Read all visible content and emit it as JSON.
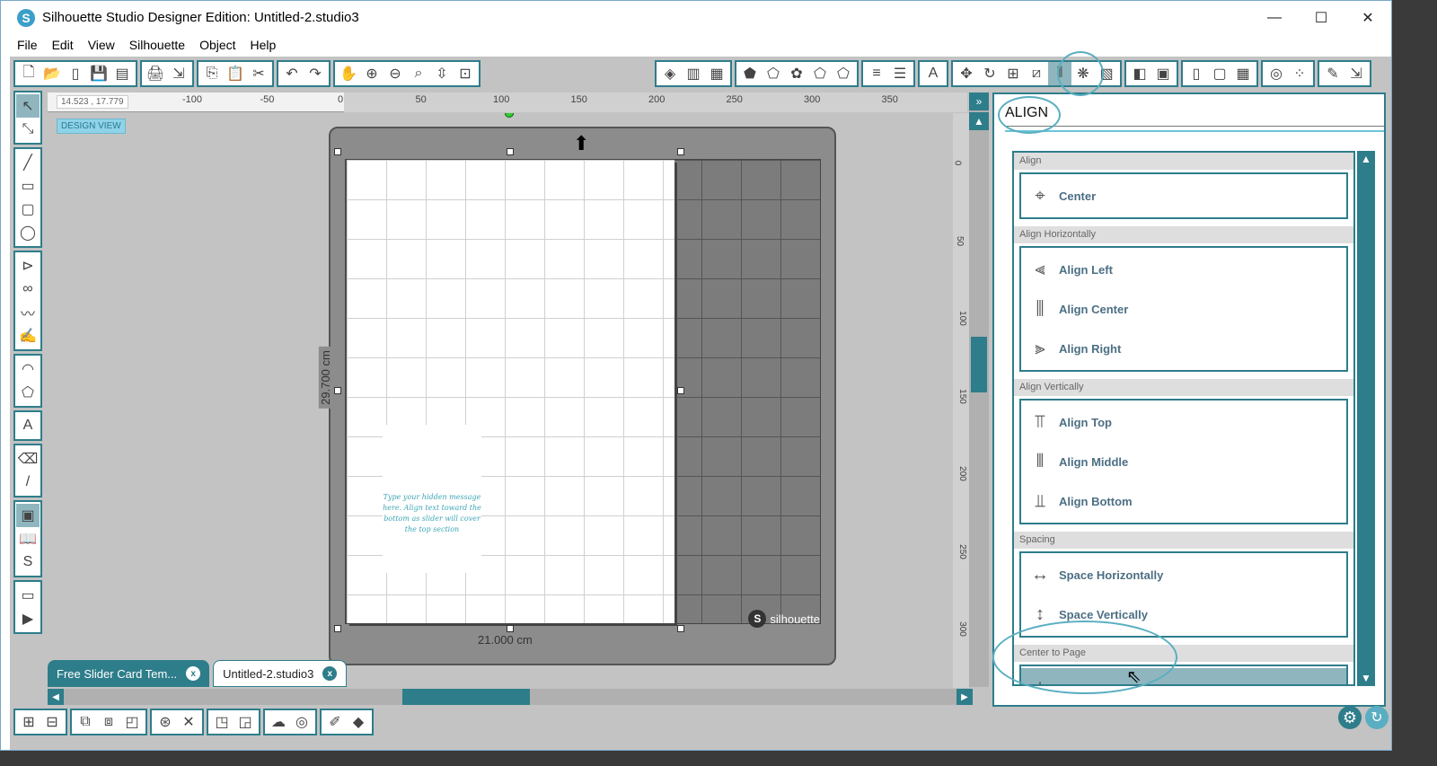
{
  "window": {
    "title": "Silhouette Studio Designer Edition: Untitled-2.studio3",
    "logo_letter": "S",
    "minimize": "—",
    "maximize": "☐",
    "close": "✕"
  },
  "menu": [
    "File",
    "Edit",
    "View",
    "Silhouette",
    "Object",
    "Help"
  ],
  "toolbar_left": [
    [
      [
        "new-page-icon",
        "🗋"
      ],
      [
        "open-icon",
        "📂"
      ],
      [
        "blank-page-icon",
        "▯"
      ],
      [
        "save-icon",
        "💾"
      ],
      [
        "save-library-icon",
        "▤"
      ]
    ],
    [
      [
        "print-icon",
        "🖨"
      ],
      [
        "send-icon",
        "⇲"
      ]
    ],
    [
      [
        "copy-icon",
        "⎘"
      ],
      [
        "paste-icon",
        "📋"
      ],
      [
        "cut-icon",
        "✂"
      ]
    ],
    [
      [
        "undo-icon",
        "↶"
      ],
      [
        "redo-icon",
        "↷"
      ]
    ],
    [
      [
        "pan-icon",
        "✋"
      ],
      [
        "zoom-in-icon",
        "⊕"
      ],
      [
        "zoom-out-icon",
        "⊖"
      ],
      [
        "zoom-select-icon",
        "⌕"
      ],
      [
        "zoom-drag-icon",
        "⇳"
      ],
      [
        "fit-page-icon",
        "⊡"
      ]
    ]
  ],
  "toolbar_right": [
    [
      [
        "fill-color-icon",
        "◈"
      ],
      [
        "gradient-icon",
        "▥"
      ],
      [
        "pattern-icon",
        "▦"
      ]
    ],
    [
      [
        "shape-fill-icon",
        "⬟"
      ],
      [
        "pentagon-icon",
        "⬠"
      ],
      [
        "flower-icon",
        "✿"
      ],
      [
        "shape-edit-icon",
        "⬠"
      ],
      [
        "knife-shape-icon",
        "⬠"
      ]
    ],
    [
      [
        "line-color-icon",
        "≡"
      ],
      [
        "line-style-icon",
        "☰"
      ]
    ],
    [
      [
        "text-style-icon",
        "A"
      ]
    ],
    [
      [
        "transform-icon",
        "✥"
      ],
      [
        "rotate-icon",
        "↻"
      ],
      [
        "scale-icon",
        "⊞"
      ],
      [
        "shear-icon",
        "⧄"
      ],
      [
        "align-icon",
        "⫴"
      ],
      [
        "replicate-icon",
        "❋"
      ],
      [
        "modify-icon",
        "▧"
      ]
    ],
    [
      [
        "trace-icon",
        "◧"
      ],
      [
        "offset-icon",
        "▣"
      ]
    ],
    [
      [
        "page-setup-icon",
        "▯"
      ],
      [
        "cut-settings-icon",
        "▢"
      ],
      [
        "grid-icon",
        "▦"
      ]
    ],
    [
      [
        "spiral-icon",
        "◎"
      ],
      [
        "dots-icon",
        "⁘"
      ]
    ],
    [
      [
        "eraser-icon",
        "✎"
      ],
      [
        "send-to-icon",
        "⇲"
      ]
    ]
  ],
  "left_tools": [
    [
      [
        "select-tool-icon",
        "↖"
      ],
      [
        "point-edit-icon",
        "⤡"
      ]
    ],
    [
      [
        "line-tool-icon",
        "╱"
      ],
      [
        "rectangle-tool-icon",
        "▭"
      ],
      [
        "rounded-rect-tool-icon",
        "▢"
      ],
      [
        "ellipse-tool-icon",
        "◯"
      ]
    ],
    [
      [
        "polygon-tool-icon",
        "⊳"
      ],
      [
        "curve-tool-icon",
        "∞"
      ],
      [
        "freehand-tool-icon",
        "〰"
      ],
      [
        "smooth-freehand-icon",
        "✍"
      ]
    ],
    [
      [
        "arc-tool-icon",
        "◠"
      ],
      [
        "regular-polygon-icon",
        "⬠"
      ]
    ],
    [
      [
        "text-tool-icon",
        "A"
      ]
    ],
    [
      [
        "eraser-tool-icon",
        "⌫"
      ],
      [
        "knife-tool-icon",
        "/"
      ]
    ],
    [
      [
        "library-view-icon",
        "▣"
      ],
      [
        "store-icon",
        "📖"
      ],
      [
        "silhouette-store-icon",
        "S"
      ]
    ],
    [
      [
        "design-view-icon",
        "▭"
      ],
      [
        "send-panel-icon",
        "▶"
      ]
    ]
  ],
  "canvas": {
    "coords": "14.523 , 17.779",
    "view_label": "DESIGN VIEW",
    "ruler_x": [
      "-100",
      "-50",
      "0",
      "50",
      "100",
      "150",
      "200",
      "250",
      "300",
      "350"
    ],
    "ruler_y": [
      "0",
      "50",
      "100",
      "150",
      "200",
      "250",
      "300"
    ],
    "width_dim": "21.000 cm",
    "height_dim": "29.700 cm",
    "brand": "silhouette",
    "message": "Type your hidden message here. Align text toward the bottom as slider will cover the top section"
  },
  "tabs": [
    {
      "label": "Free Slider Card Tem...",
      "close": "x"
    },
    {
      "label": "Untitled-2.studio3",
      "close": "x"
    }
  ],
  "panel": {
    "title": "ALIGN",
    "sections": [
      {
        "header": "Align",
        "items": [
          [
            "center-icon",
            "⌖",
            "Center"
          ]
        ]
      },
      {
        "header": "Align Horizontally",
        "items": [
          [
            "align-left-icon",
            "⫷",
            "Align Left"
          ],
          [
            "align-center-icon",
            "⫼",
            "Align Center"
          ],
          [
            "align-right-icon",
            "⫸",
            "Align Right"
          ]
        ]
      },
      {
        "header": "Align Vertically",
        "items": [
          [
            "align-top-icon",
            "⫪",
            "Align Top"
          ],
          [
            "align-middle-icon",
            "⫴",
            "Align Middle"
          ],
          [
            "align-bottom-icon",
            "⫫",
            "Align Bottom"
          ]
        ]
      },
      {
        "header": "Spacing",
        "items": [
          [
            "space-horizontally-icon",
            "↔",
            "Space Horizontally"
          ],
          [
            "space-vertically-icon",
            "↕",
            "Space Vertically"
          ]
        ]
      },
      {
        "header": "Center to Page",
        "items": [
          [
            "center-to-page-icon",
            "⊹",
            "Center to Page"
          ]
        ]
      }
    ]
  },
  "bottom_toolbar": [
    [
      [
        "group-icon",
        "⊞"
      ],
      [
        "ungroup-icon",
        "⊟"
      ]
    ],
    [
      [
        "compound-icon",
        "⧉"
      ],
      [
        "release-compound-icon",
        "⧈"
      ],
      [
        "bring-forward-icon",
        "◰"
      ]
    ],
    [
      [
        "weld-icon",
        "⊛"
      ],
      [
        "delete-icon",
        "✕"
      ]
    ],
    [
      [
        "bring-to-front-icon",
        "◳"
      ],
      [
        "send-to-back-icon",
        "◲"
      ]
    ],
    [
      [
        "cloud-icon",
        "☁"
      ],
      [
        "offset-ring-icon",
        "◎"
      ]
    ],
    [
      [
        "sketch-icon",
        "✐"
      ],
      [
        "library-icon",
        "◆"
      ]
    ]
  ],
  "accent_color": "#2e7d8a"
}
